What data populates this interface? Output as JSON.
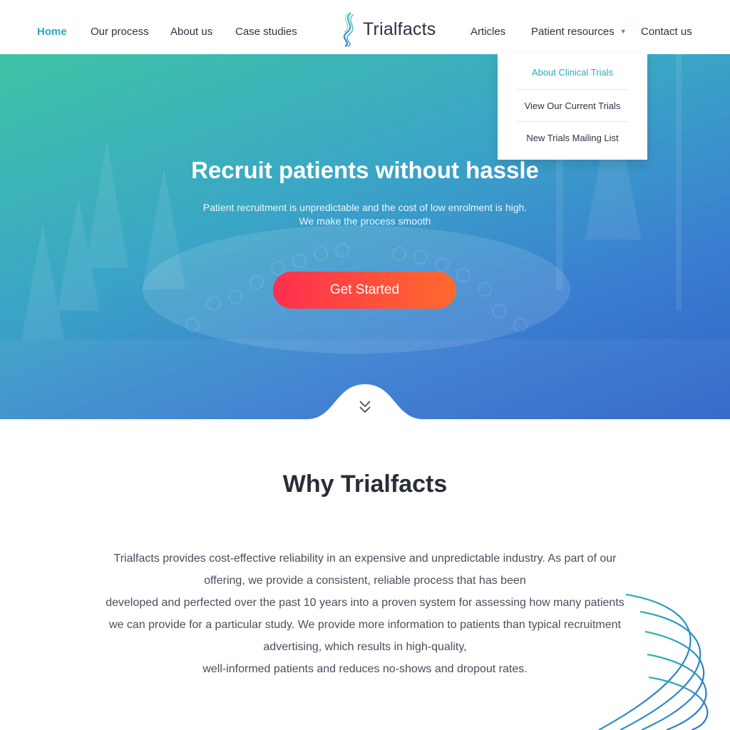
{
  "nav": {
    "left_items": [
      {
        "label": "Home",
        "active": true
      },
      {
        "label": "Our process",
        "active": false
      },
      {
        "label": "About us",
        "active": false
      },
      {
        "label": "Case studies",
        "active": false
      }
    ],
    "brand": "Trialfacts",
    "right_items": [
      {
        "label": "Articles"
      },
      {
        "label": "Patient resources",
        "icon": "caret-down-icon"
      },
      {
        "label": "Contact us"
      }
    ]
  },
  "dropdown": {
    "items": [
      {
        "label": "About Clinical Trials",
        "highlighted": true
      },
      {
        "label": "View Our Current Trials",
        "highlighted": false
      },
      {
        "label": "New Trials Mailing List",
        "highlighted": false
      }
    ]
  },
  "hero": {
    "title": "Recruit patients without hassle",
    "subtitle_line1": "Patient recruitment is unpredictable and the cost of low enrolment is high.",
    "subtitle_line2": "We make the process smooth",
    "cta_label": "Get Started",
    "scroll_icon": "double-chevron-down-icon"
  },
  "why": {
    "title": "Why Trialfacts",
    "lines": [
      "Trialfacts provides cost-effective reliability in an expensive and unpredictable industry. As part of our",
      "offering, we provide a consistent, reliable process that has been",
      "developed and perfected over the past 10 years into a proven system for assessing how many patients",
      "we can provide for a particular study. We provide more information to patients than typical recruitment",
      "advertising, which results in high-quality,",
      "well-informed patients and reduces no-shows and dropout rates."
    ]
  },
  "colors": {
    "accent": "#2aa9c2",
    "cta_start": "#ff2f4f",
    "cta_end": "#ff6a2d",
    "hero_start": "#3fc4a6",
    "hero_end": "#2e63c9"
  }
}
